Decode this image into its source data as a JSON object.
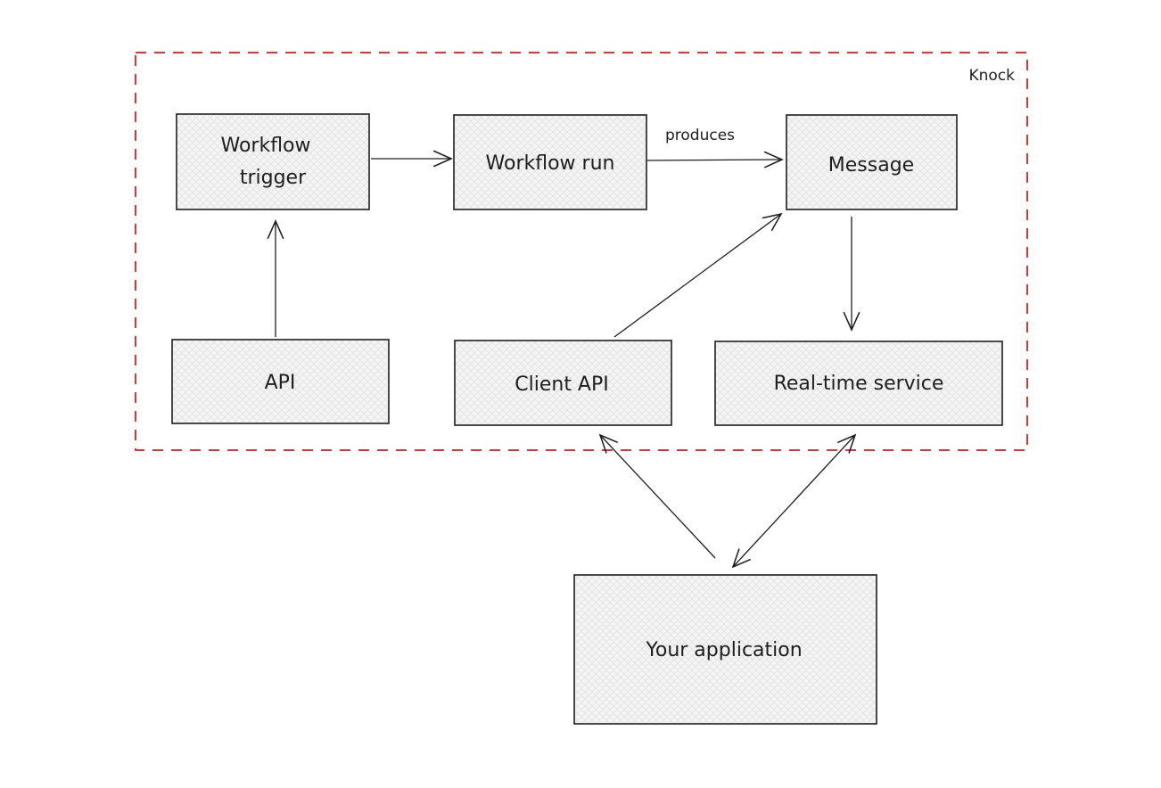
{
  "diagram": {
    "group": {
      "label": "Knock",
      "border_color": "#d33b3b"
    },
    "nodes": {
      "workflow_trigger": {
        "lines": [
          "Workflow",
          "trigger"
        ]
      },
      "workflow_run": {
        "label": "Workflow run"
      },
      "message": {
        "label": "Message"
      },
      "api": {
        "label": "API"
      },
      "client_api": {
        "label": "Client API"
      },
      "realtime_service": {
        "label": "Real-time service"
      },
      "your_application": {
        "label": "Your application"
      }
    },
    "edges": [
      {
        "from": "api",
        "to": "workflow_trigger",
        "label": ""
      },
      {
        "from": "workflow_trigger",
        "to": "workflow_run",
        "label": ""
      },
      {
        "from": "workflow_run",
        "to": "message",
        "label": "produces"
      },
      {
        "from": "client_api",
        "to": "message",
        "label": ""
      },
      {
        "from": "message",
        "to": "realtime_service",
        "label": ""
      },
      {
        "from": "your_application",
        "to": "client_api",
        "label": ""
      },
      {
        "from": "realtime_service",
        "to": "your_application",
        "label": "",
        "bidirectional": true
      }
    ],
    "colors": {
      "stroke": "#1e1e1e",
      "fill": "#f3f3f3"
    }
  }
}
